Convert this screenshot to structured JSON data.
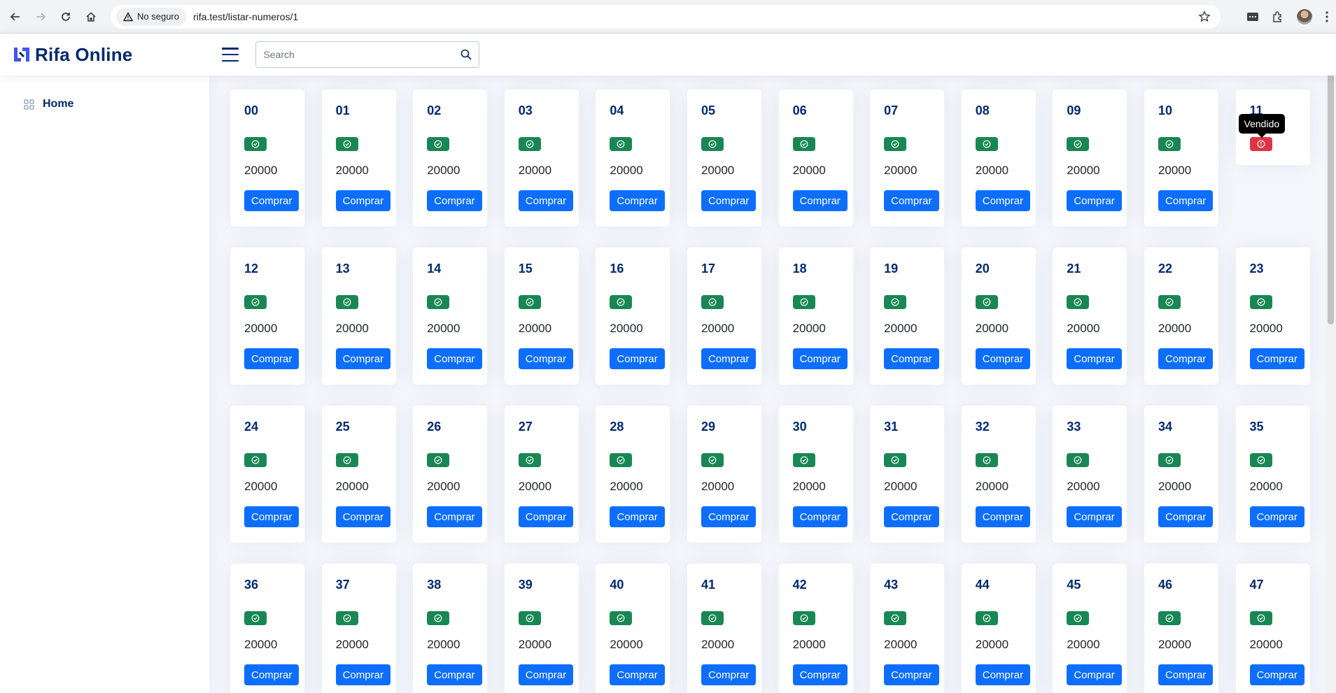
{
  "browser": {
    "security_label": "No seguro",
    "url": "rifa.test/listar-numeros/1"
  },
  "header": {
    "title": "Rifa Online",
    "search_placeholder": "Search"
  },
  "sidebar": {
    "items": [
      {
        "label": "Home",
        "icon": "grid-icon"
      }
    ]
  },
  "colors": {
    "primary": "#012970",
    "available": "#198754",
    "sold": "#dc3545",
    "button": "#0d6efd"
  },
  "numbers": {
    "price": "20000",
    "buy_label": "Comprar",
    "sold_tooltip": "Vendido",
    "items": [
      {
        "number": "00",
        "status": "available"
      },
      {
        "number": "01",
        "status": "available"
      },
      {
        "number": "02",
        "status": "available"
      },
      {
        "number": "03",
        "status": "available"
      },
      {
        "number": "04",
        "status": "available"
      },
      {
        "number": "05",
        "status": "available"
      },
      {
        "number": "06",
        "status": "available"
      },
      {
        "number": "07",
        "status": "available"
      },
      {
        "number": "08",
        "status": "available"
      },
      {
        "number": "09",
        "status": "available"
      },
      {
        "number": "10",
        "status": "available"
      },
      {
        "number": "11",
        "status": "sold"
      },
      {
        "number": "12",
        "status": "available"
      },
      {
        "number": "13",
        "status": "available"
      },
      {
        "number": "14",
        "status": "available"
      },
      {
        "number": "15",
        "status": "available"
      },
      {
        "number": "16",
        "status": "available"
      },
      {
        "number": "17",
        "status": "available"
      },
      {
        "number": "18",
        "status": "available"
      },
      {
        "number": "19",
        "status": "available"
      },
      {
        "number": "20",
        "status": "available"
      },
      {
        "number": "21",
        "status": "available"
      },
      {
        "number": "22",
        "status": "available"
      },
      {
        "number": "23",
        "status": "available"
      },
      {
        "number": "24",
        "status": "available"
      },
      {
        "number": "25",
        "status": "available"
      },
      {
        "number": "26",
        "status": "available"
      },
      {
        "number": "27",
        "status": "available"
      },
      {
        "number": "28",
        "status": "available"
      },
      {
        "number": "29",
        "status": "available"
      },
      {
        "number": "30",
        "status": "available"
      },
      {
        "number": "31",
        "status": "available"
      },
      {
        "number": "32",
        "status": "available"
      },
      {
        "number": "33",
        "status": "available"
      },
      {
        "number": "34",
        "status": "available"
      },
      {
        "number": "35",
        "status": "available"
      },
      {
        "number": "36",
        "status": "available"
      },
      {
        "number": "37",
        "status": "available"
      },
      {
        "number": "38",
        "status": "available"
      },
      {
        "number": "39",
        "status": "available"
      },
      {
        "number": "40",
        "status": "available"
      },
      {
        "number": "41",
        "status": "available"
      },
      {
        "number": "42",
        "status": "available"
      },
      {
        "number": "43",
        "status": "available"
      },
      {
        "number": "44",
        "status": "available"
      },
      {
        "number": "45",
        "status": "available"
      },
      {
        "number": "46",
        "status": "available"
      },
      {
        "number": "47",
        "status": "available"
      }
    ]
  }
}
